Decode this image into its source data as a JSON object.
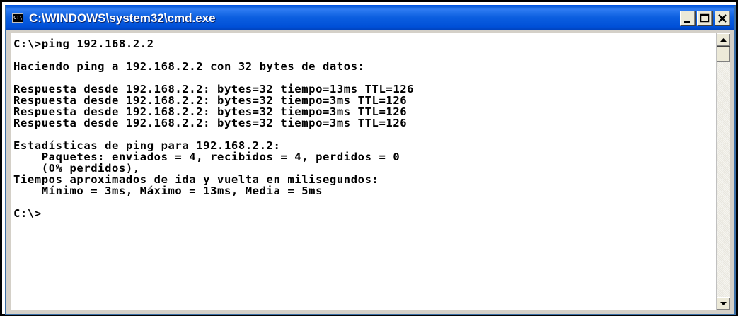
{
  "window": {
    "title": "C:\\WINDOWS\\system32\\cmd.exe",
    "icon": "cmd-icon",
    "icon_text": "C:\\",
    "controls": [
      "minimize",
      "maximize",
      "close"
    ]
  },
  "console": {
    "lines": [
      "C:\\>ping 192.168.2.2",
      "",
      "Haciendo ping a 192.168.2.2 con 32 bytes de datos:",
      "",
      "Respuesta desde 192.168.2.2: bytes=32 tiempo=13ms TTL=126",
      "Respuesta desde 192.168.2.2: bytes=32 tiempo=3ms TTL=126",
      "Respuesta desde 192.168.2.2: bytes=32 tiempo=3ms TTL=126",
      "Respuesta desde 192.168.2.2: bytes=32 tiempo=3ms TTL=126",
      "",
      "Estadísticas de ping para 192.168.2.2:",
      "    Paquetes: enviados = 4, recibidos = 4, perdidos = 0",
      "    (0% perdidos),",
      "Tiempos aproximados de ida y vuelta en milisegundos:",
      "    Mínimo = 3ms, Máximo = 13ms, Media = 5ms",
      "",
      "C:\\>"
    ]
  },
  "colors": {
    "titlebar": "#0054e3",
    "console_background": "#ffffff",
    "console_text": "#000000"
  }
}
